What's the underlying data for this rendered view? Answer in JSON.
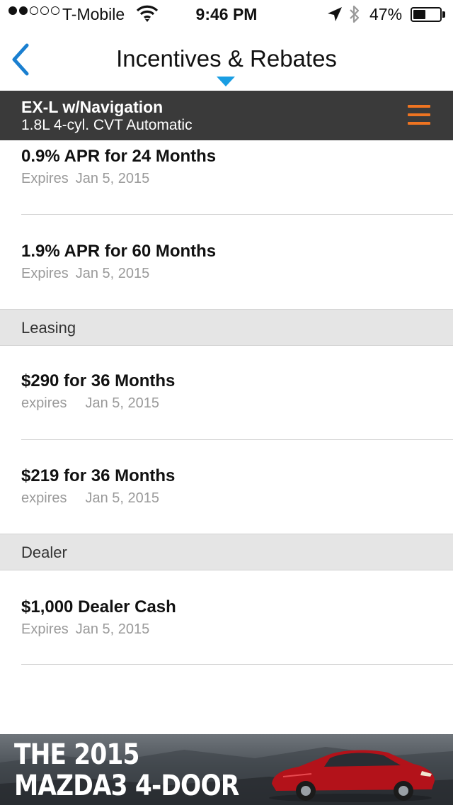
{
  "status_bar": {
    "carrier": "T-Mobile",
    "signal_bars_filled": 2,
    "signal_bars_total": 5,
    "time": "9:46 PM",
    "battery_percent": "47%",
    "battery_level": 0.47
  },
  "nav": {
    "title": "Incentives & Rebates",
    "accent_color": "#1a9ee3"
  },
  "trim": {
    "name": "EX-L w/Navigation",
    "engine": "1.8L 4-cyl. CVT Automatic",
    "menu_color": "#ef7421"
  },
  "offers": [
    {
      "title": "0.9% APR for 24 Months",
      "expires_label": "Expires",
      "expires_date": "Jan 5, 2015"
    },
    {
      "title": "1.9% APR for 60 Months",
      "expires_label": "Expires",
      "expires_date": "Jan 5, 2015"
    }
  ],
  "leasing": {
    "header": "Leasing",
    "items": [
      {
        "title": "$290 for 36 Months",
        "expires_label": "expires",
        "expires_date": "Jan 5, 2015"
      },
      {
        "title": "$219 for 36 Months",
        "expires_label": "expires",
        "expires_date": "Jan 5, 2015"
      }
    ]
  },
  "dealer": {
    "header": "Dealer",
    "items": [
      {
        "title": "$1,000 Dealer Cash",
        "expires_label": "Expires",
        "expires_date": "Jan 5, 2015"
      }
    ]
  },
  "ad": {
    "line1": "THE 2015",
    "line2": "MAZDA3 4-DOOR",
    "car_color": "#b3121a"
  }
}
